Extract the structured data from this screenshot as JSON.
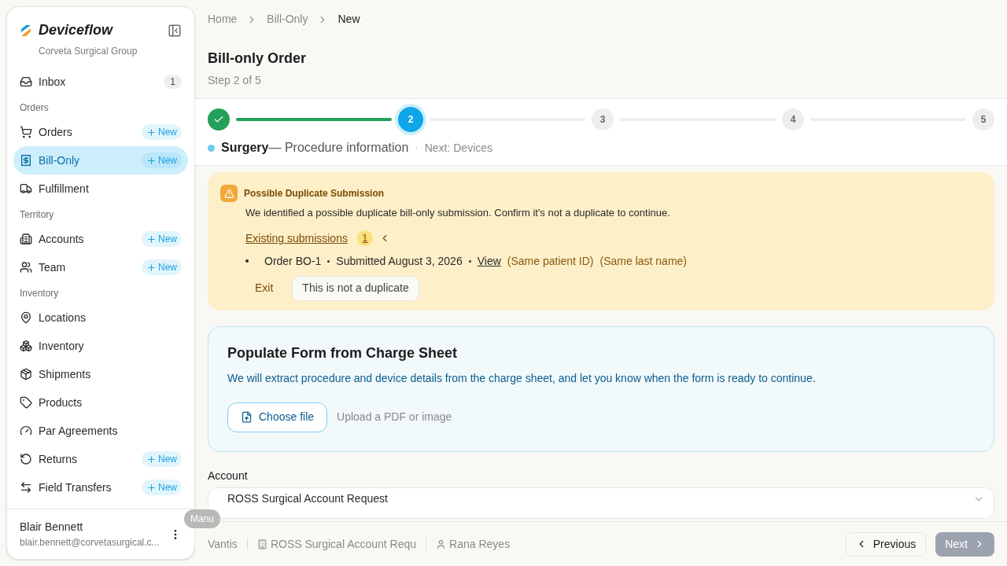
{
  "sidebar": {
    "brand": "Deviceflow",
    "org": "Corveta Surgical Group",
    "sections": [
      {
        "items": [
          {
            "label": "Inbox",
            "count": "1",
            "selected": false
          }
        ]
      },
      {
        "title": "Orders",
        "items": [
          {
            "label": "Orders",
            "new": "New",
            "selected": false
          },
          {
            "label": "Bill-Only",
            "new": "New",
            "selected": true
          },
          {
            "label": "Fulfillment",
            "selected": false
          }
        ]
      },
      {
        "title": "Territory",
        "items": [
          {
            "label": "Accounts",
            "new": "New",
            "selected": false
          },
          {
            "label": "Team",
            "new": "New",
            "selected": false
          }
        ]
      },
      {
        "title": "Inventory",
        "items": [
          {
            "label": "Locations",
            "selected": false
          },
          {
            "label": "Inventory",
            "selected": false
          },
          {
            "label": "Shipments",
            "selected": false
          },
          {
            "label": "Products",
            "selected": false
          },
          {
            "label": "Par Agreements",
            "selected": false
          },
          {
            "label": "Returns",
            "new": "New",
            "selected": false
          },
          {
            "label": "Field Transfers",
            "new": "New",
            "selected": false
          }
        ]
      }
    ],
    "user": {
      "name": "Blair Bennett",
      "email": "blair.bennett@corvetasurgical.c..."
    }
  },
  "breadcrumb": [
    "Home",
    "Bill-Only",
    "New"
  ],
  "header": {
    "title": "Bill-only Order",
    "subtitle": "Step 2 of 5"
  },
  "stepper": {
    "steps": [
      {
        "kind": "done"
      },
      {
        "kind": "current",
        "label": "2"
      },
      {
        "kind": "upcoming",
        "label": "3"
      },
      {
        "kind": "upcoming",
        "label": "4"
      },
      {
        "kind": "upcoming",
        "label": "5"
      }
    ],
    "current_name": "Surgery",
    "current_desc": "— Procedure information",
    "separator": "·",
    "next": "Next: Devices"
  },
  "alert": {
    "title": "Possible Duplicate Submission",
    "message": "We identified a possible duplicate bill-only submission. Confirm it's not a duplicate to continue.",
    "link": "Existing submissions",
    "count": "1",
    "expanded": true,
    "submissions": [
      {
        "order": "Order BO-1",
        "submitted": "Submitted August 3, 2026",
        "view": "View",
        "tags": [
          "(Same patient ID)",
          "(Same last name)"
        ]
      }
    ],
    "exit": "Exit",
    "confirm": "This is not a duplicate"
  },
  "charge_sheet": {
    "title": "Populate Form from Charge Sheet",
    "description": "We will extract procedure and device details from the charge sheet, and let you know when the form is ready to continue.",
    "button": "Choose file",
    "hint": "Upload a PDF or image"
  },
  "account": {
    "label": "Account",
    "value": "ROSS Surgical Account Request"
  },
  "tooltip": "Manu",
  "footer": {
    "items": [
      "Vantis",
      "ROSS Surgical Account Requ",
      "Rana Reyes"
    ],
    "previous": "Previous",
    "next": "Next",
    "next_disabled": true
  }
}
